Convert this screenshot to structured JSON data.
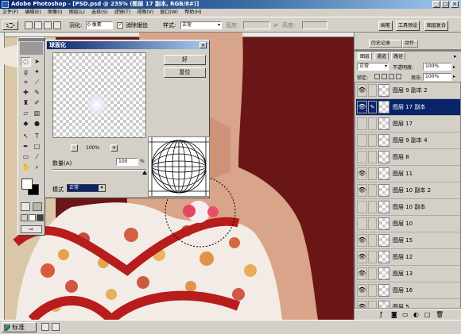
{
  "app": {
    "title": "Adobe Photoshop - [PSD.psd @ 235% (图层 17 副本, RGB/8#)]"
  },
  "menu": [
    "文件(F)",
    "编辑(E)",
    "图像(I)",
    "图层(L)",
    "选择(S)",
    "滤镜(T)",
    "视图(V)",
    "窗口(W)",
    "帮助(H)"
  ],
  "options_bar": {
    "feather_label": "羽化:",
    "feather_value": "0 像素",
    "antialias_label": "消除锯齿",
    "style_label": "样式:",
    "style_value": "正常",
    "width_label": "宽度:",
    "height_label": "高度:",
    "well_tabs": [
      "画笔",
      "工具预设",
      "图层复合"
    ]
  },
  "dialog": {
    "title": "球面化",
    "ok": "好",
    "reset": "复位",
    "zoom": "100%",
    "amount_label": "数量(A)",
    "amount_value": "100",
    "amount_unit": "%",
    "mode_label": "模式",
    "mode_value": "正常",
    "zoom_out": "-",
    "zoom_in": "+"
  },
  "history_tabs": [
    "历史记录",
    "动作"
  ],
  "layers_panel": {
    "tabs": [
      "图层",
      "通道",
      "路径"
    ],
    "blend_mode": "正常",
    "opacity_label": "不透明度:",
    "opacity": "100%",
    "lock_label": "锁定:",
    "fill_label": "填充:",
    "fill": "100%",
    "layers": [
      {
        "name": "图层 9 副本 2",
        "visible": true
      },
      {
        "name": "图层 17 副本",
        "visible": true,
        "active": true
      },
      {
        "name": "图层 17",
        "visible": false
      },
      {
        "name": "图层 9 副本 4",
        "visible": false
      },
      {
        "name": "图层 8",
        "visible": false
      },
      {
        "name": "图层 11",
        "visible": true
      },
      {
        "name": "图层 10 副本 2",
        "visible": true
      },
      {
        "name": "图层 10 副本",
        "visible": false
      },
      {
        "name": "图层 10",
        "visible": false
      },
      {
        "name": "图层 15",
        "visible": true
      },
      {
        "name": "图层 12",
        "visible": true
      },
      {
        "name": "图层 13",
        "visible": true
      },
      {
        "name": "图层 16",
        "visible": true
      },
      {
        "name": "图层 5",
        "visible": true
      }
    ]
  },
  "statusbar": {
    "start": "标准"
  },
  "colors": {
    "canvas_bg": "#6b1616",
    "title_bg": "#0a246a",
    "selected_layer": "#0a246a"
  }
}
